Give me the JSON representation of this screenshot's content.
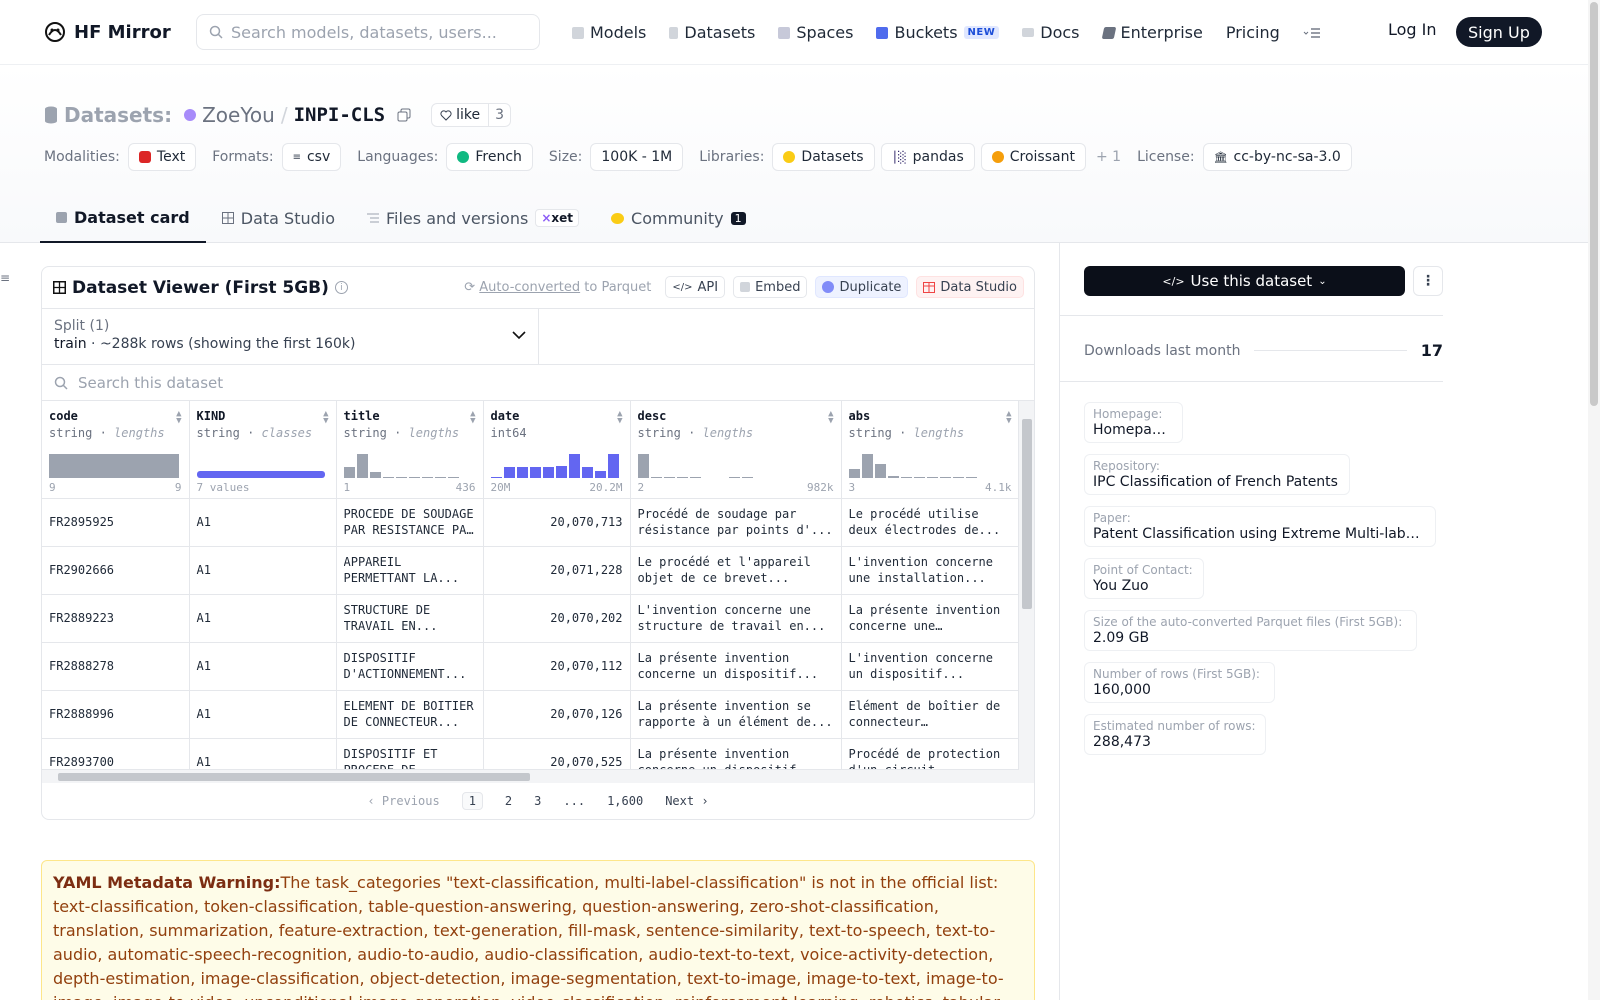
{
  "nav": {
    "brand": "HF Mirror",
    "search_placeholder": "Search models, datasets, users...",
    "links": {
      "models": "Models",
      "datasets": "Datasets",
      "spaces": "Spaces",
      "buckets": "Buckets",
      "buckets_badge": "NEW",
      "docs": "Docs",
      "enterprise": "Enterprise",
      "pricing": "Pricing"
    },
    "login": "Log In",
    "signup": "Sign Up"
  },
  "header": {
    "label": "Datasets:",
    "user": "ZoeYou",
    "separator": "/",
    "repo": "INPI-CLS",
    "like_label": "like",
    "like_count": "3",
    "meta": {
      "modalities_label": "Modalities:",
      "modality": "Text",
      "formats_label": "Formats:",
      "format": "csv",
      "languages_label": "Languages:",
      "language": "French",
      "size_label": "Size:",
      "size": "100K - 1M",
      "libraries_label": "Libraries:",
      "lib1": "Datasets",
      "lib2": "pandas",
      "lib3": "Croissant",
      "lib_more": "+ 1",
      "license_label": "License:",
      "license": "cc-by-nc-sa-3.0"
    },
    "tabs": {
      "card": "Dataset card",
      "studio": "Data Studio",
      "files": "Files and versions",
      "xet": "xet",
      "community": "Community",
      "community_count": "1"
    }
  },
  "viewer": {
    "title": "Dataset Viewer (First 5GB)",
    "auto_prefix": "Auto-converted",
    "auto_suffix": "to Parquet",
    "api": "API",
    "embed": "Embed",
    "duplicate": "Duplicate",
    "data_studio": "Data Studio",
    "split_label": "Split (1)",
    "split_name": "train",
    "split_info": "·  ~288k rows (showing the first 160k)",
    "search_placeholder": "Search this dataset",
    "columns": [
      {
        "name": "code",
        "type": "string",
        "stat": "lengths",
        "min": "9",
        "max": "9"
      },
      {
        "name": "KIND",
        "type": "string",
        "stat": "classes",
        "min": "7 values",
        "max": ""
      },
      {
        "name": "title",
        "type": "string",
        "stat": "lengths",
        "min": "1",
        "max": "436"
      },
      {
        "name": "date",
        "type": "int64",
        "stat": "",
        "min": "20M",
        "max": "20.2M"
      },
      {
        "name": "desc",
        "type": "string",
        "stat": "lengths",
        "min": "2",
        "max": "982k"
      },
      {
        "name": "abs",
        "type": "string",
        "stat": "lengths",
        "min": "3",
        "max": "4.1k"
      }
    ],
    "rows": [
      {
        "code": "FR2895925",
        "kind": "A1",
        "title": "PROCEDE DE SOUDAGE PAR RESISTANCE PAR POINTS",
        "date": "20,070,713",
        "desc": "Procédé de soudage par résistance par points d'...",
        "abs": "Le procédé utilise deux électrodes de..."
      },
      {
        "code": "FR2902666",
        "kind": "A1",
        "title": "APPAREIL PERMETTANT LA...",
        "date": "20,071,228",
        "desc": "Le procédé et l'appareil objet de ce brevet...",
        "abs": "L'invention concerne une installation..."
      },
      {
        "code": "FR2889223",
        "kind": "A1",
        "title": "STRUCTURE DE TRAVAIL EN...",
        "date": "20,070,202",
        "desc": "L'invention concerne une structure de travail en...",
        "abs": "La présente invention concerne une structure..."
      },
      {
        "code": "FR2888278",
        "kind": "A1",
        "title": "DISPOSITIF D'ACTIONNEMENT...",
        "date": "20,070,112",
        "desc": "La présente invention concerne un dispositif...",
        "abs": "L'invention concerne un dispositif..."
      },
      {
        "code": "FR2888996",
        "kind": "A1",
        "title": "ELEMENT DE BOITIER DE CONNECTEUR...",
        "date": "20,070,126",
        "desc": "La présente invention se rapporte à un élément de...",
        "abs": "Elément de boîtier de connecteur électrique..."
      },
      {
        "code": "FR2893700",
        "kind": "A1",
        "title": "DISPOSITIF ET PROCEDE DE",
        "date": "20,070,525",
        "desc": "La présente invention concerne un dispositif",
        "abs": "Procédé de protection d'un circuit"
      }
    ],
    "pager": {
      "prev": "Previous",
      "p1": "1",
      "p2": "2",
      "p3": "3",
      "ellipsis": "...",
      "last": "1,600",
      "next": "Next"
    }
  },
  "yaml_warning": {
    "title": "YAML Metadata Warning:",
    "text": "The task_categories \"text-classification, multi-label-classification\" is not in the official list: text-classification, token-classification, table-question-answering, question-answering, zero-shot-classification, translation, summarization, feature-extraction, text-generation, fill-mask, sentence-similarity, text-to-speech, text-to-audio, automatic-speech-recognition, audio-to-audio, audio-classification, audio-text-to-text, voice-activity-detection, depth-estimation, image-classification, object-detection, image-segmentation, text-to-image, image-to-text, image-to-image, image-to-video, unconditional-image-generation, video-classification, reinforcement-learning, robotics, tabular-"
  },
  "sidebar": {
    "use_dataset": "Use this dataset",
    "downloads_label": "Downloads last month",
    "downloads": "17",
    "homepage_label": "Homepage:",
    "homepage_value": "Homepage:",
    "repo_label": "Repository:",
    "repo_value": "IPC Classification of French Patents",
    "paper_label": "Paper:",
    "paper_value": "Patent Classification using Extreme Multi-label...",
    "contact_label": "Point of Contact:",
    "contact_value": "You Zuo",
    "parquet_label": "Size of the auto-converted Parquet files (First 5GB):",
    "parquet_value": "2.09 GB",
    "rows_label": "Number of rows (First 5GB):",
    "rows_value": "160,000",
    "est_label": "Estimated number of rows:",
    "est_value": "288,473"
  },
  "colors": {
    "accent_purple": "#6366f1",
    "dark": "#111827",
    "warning_bg": "#fefce8"
  }
}
